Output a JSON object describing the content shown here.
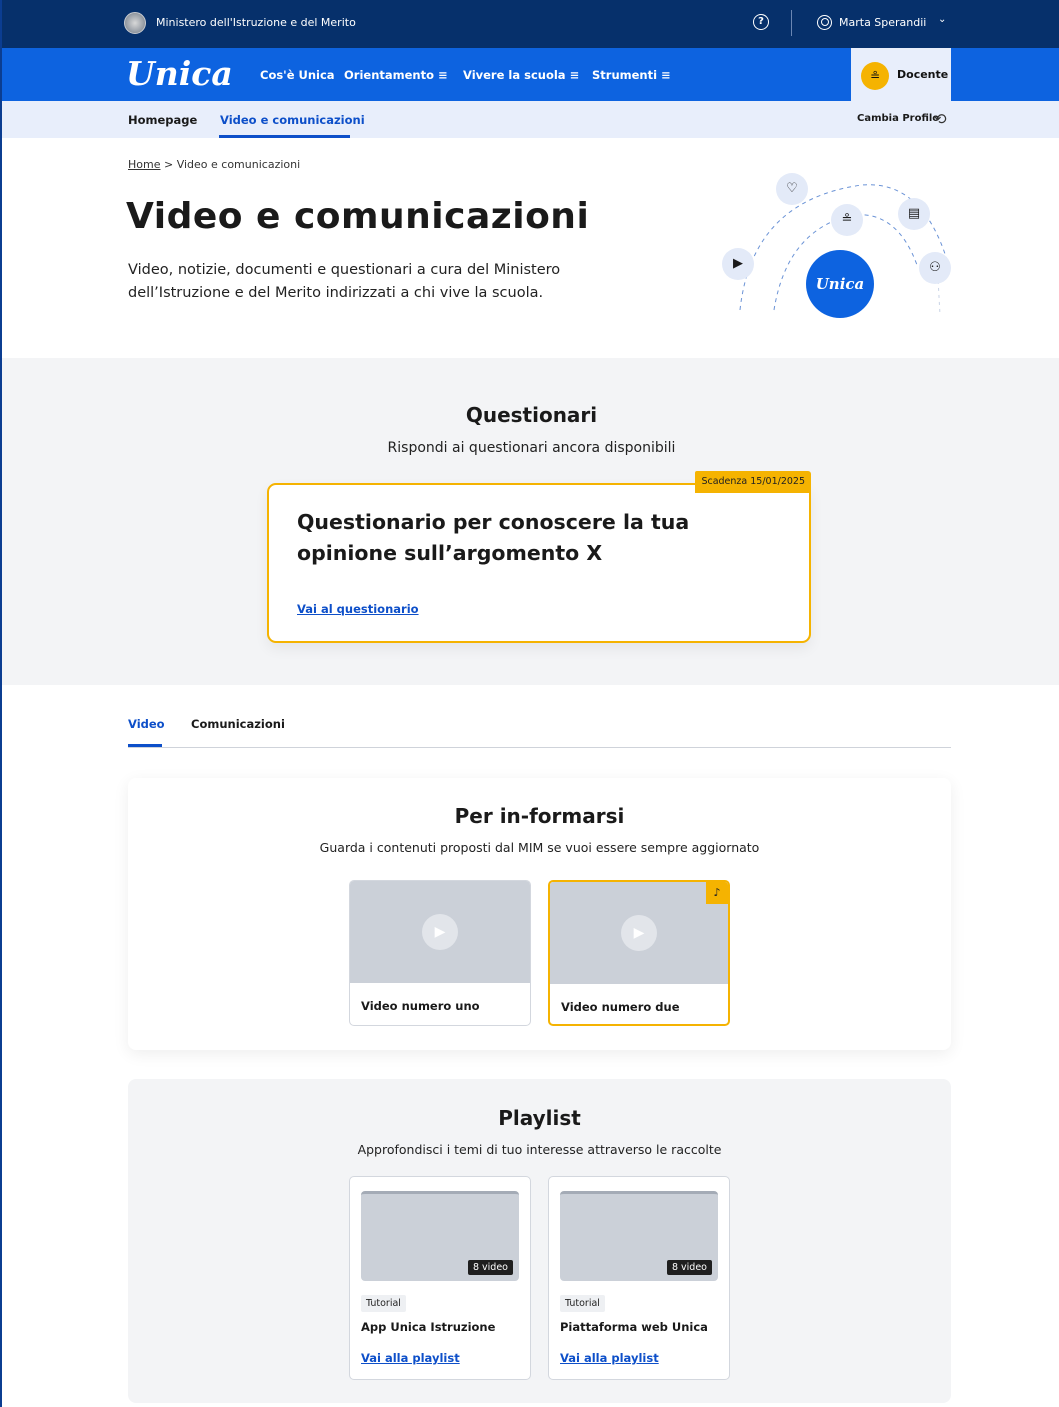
{
  "topbar": {
    "ministry": "Ministero dell'Istruzione e del Merito",
    "help_icon": "question-circle-icon",
    "user_name": "Marta Sperandii",
    "chevron": "⌄"
  },
  "nav": {
    "logo": "Unica",
    "items": [
      {
        "label": "Cos'è Unica"
      },
      {
        "label": "Orientamento ≡"
      },
      {
        "label": "Vivere la scuola ≡"
      },
      {
        "label": "Strumenti ≡"
      }
    ],
    "profile_label": "Docente",
    "profile_icon": "teacher-icon"
  },
  "subnav": {
    "items": [
      {
        "label": "Homepage"
      },
      {
        "label": "Video e comunicazioni"
      }
    ],
    "change_profile": "Cambia Profilo"
  },
  "hero": {
    "breadcrumb_home": "Home",
    "breadcrumb_sep": ">",
    "breadcrumb_current": "Video e comunicazioni",
    "title": "Video e comunicazioni",
    "description": "Video, notizie, documenti e questionari a cura del Ministero dell’Istruzione e del Merito indirizzati a chi vive la scuola.",
    "art_logo": "Unica"
  },
  "questionari": {
    "title": "Questionari",
    "subtitle": "Rispondi ai questionari ancora disponibili",
    "card": {
      "deadline": "Scadenza 15/01/2025",
      "title": "Questionario per conoscere la tua opinione sull’argomento X",
      "link": "Vai al questionario"
    }
  },
  "tabs": [
    {
      "label": "Video",
      "active": true
    },
    {
      "label": "Comunicazioni",
      "active": false
    }
  ],
  "informarsi": {
    "title": "Per in-formarsi",
    "subtitle": "Guarda i contenuti proposti dal MIM se vuoi essere sempre aggiornato",
    "videos": [
      {
        "title": "Video numero uno"
      },
      {
        "title": "Video numero due"
      }
    ]
  },
  "playlist": {
    "title": "Playlist",
    "subtitle": "Approfondisci i temi di tuo interesse attraverso le raccolte",
    "items": [
      {
        "count": "8 video",
        "tag": "Tutorial",
        "title": "App Unica Istruzione",
        "link": "Vai alla playlist"
      },
      {
        "count": "8 video",
        "tag": "Tutorial",
        "title": "Piattaforma web Unica",
        "link": "Vai alla playlist"
      }
    ]
  },
  "colors": {
    "topbar": "#06306b",
    "nav": "#0d63e0",
    "accent": "#0d4fc9",
    "highlight": "#f5b301"
  }
}
